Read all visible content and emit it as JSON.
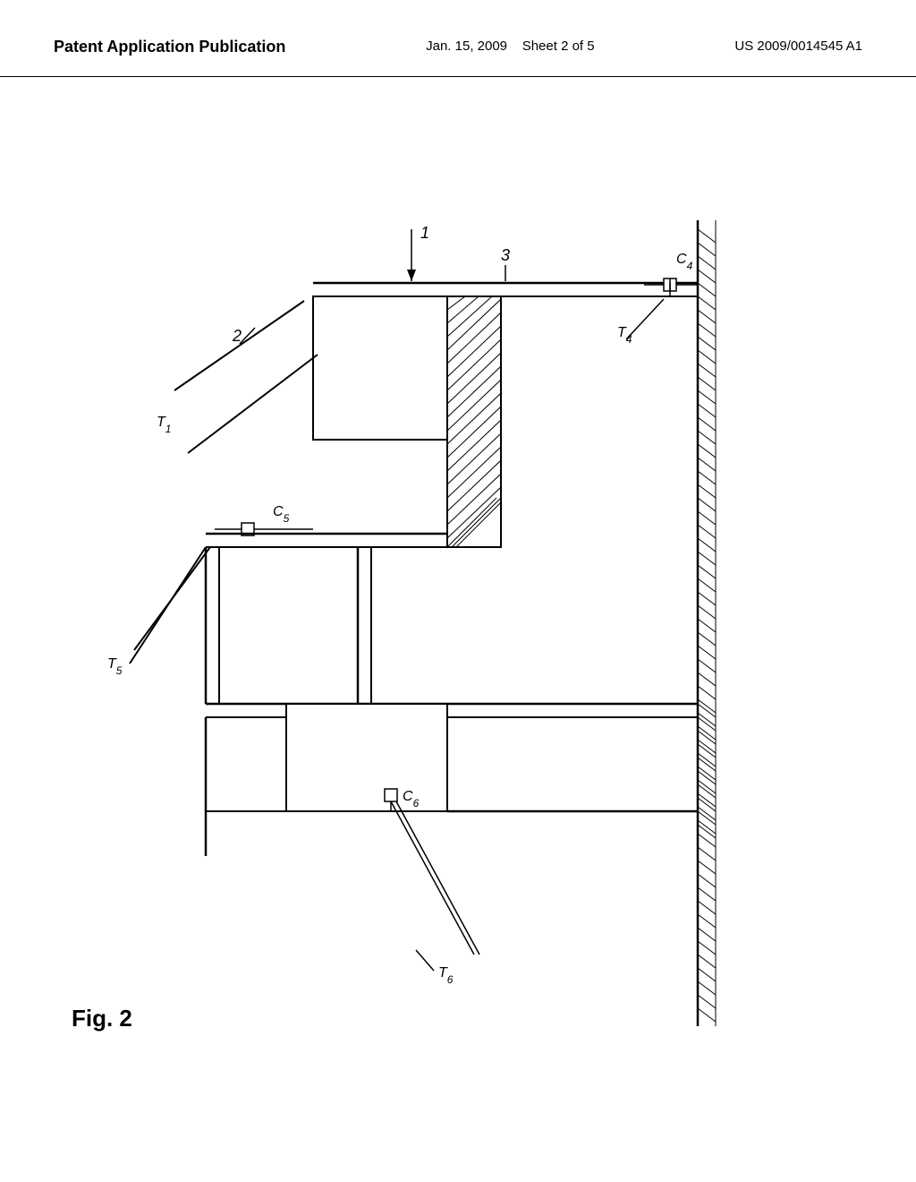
{
  "header": {
    "left_label": "Patent Application Publication",
    "center_date": "Jan. 15, 2009",
    "center_sheet": "Sheet 2 of 5",
    "right_patent": "US 2009/0014545 A1"
  },
  "figure": {
    "label": "Fig. 2",
    "number": "1",
    "labels": {
      "n1": "1",
      "n2": "2",
      "n3": "3",
      "T1": "T₁",
      "T4": "T₄",
      "T5": "T₅",
      "T6": "T₆",
      "C4": "C₄",
      "C5": "C₅",
      "C6": "C₆"
    }
  }
}
